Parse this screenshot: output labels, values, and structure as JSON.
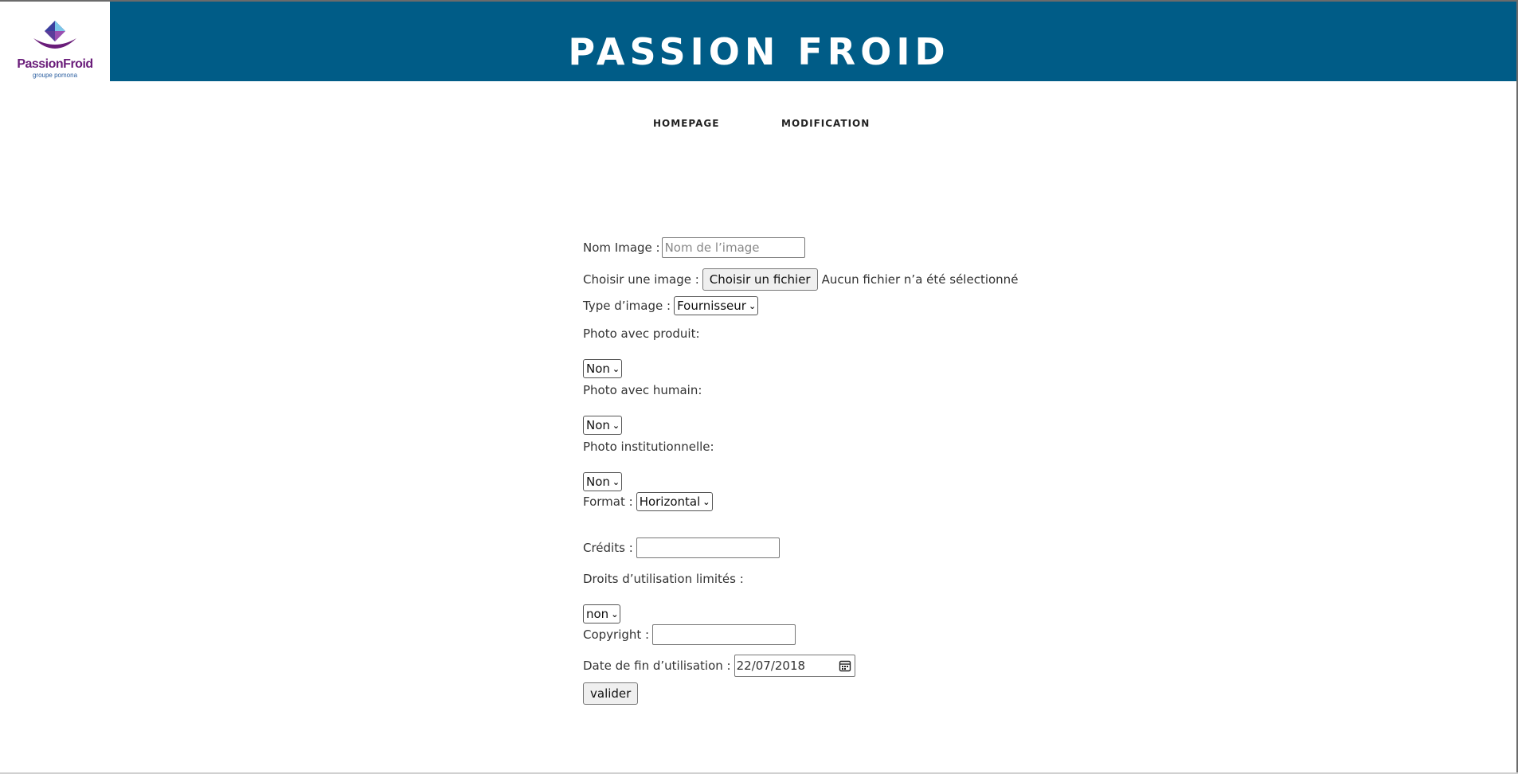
{
  "header": {
    "logo_name": "PassionFroid",
    "logo_sub": "groupe pomona",
    "title": "PASSION FROID"
  },
  "nav": {
    "items": [
      {
        "label": "HOMEPAGE"
      },
      {
        "label": "MODIFICATION"
      }
    ]
  },
  "form": {
    "nom_image": {
      "label": "Nom Image :",
      "placeholder": "Nom de l’image",
      "value": ""
    },
    "choisir_image": {
      "label": "Choisir une image :",
      "button": "Choisir un fichier",
      "status": "Aucun fichier n’a été sélectionné"
    },
    "type_image": {
      "label": "Type d’image :",
      "selected": "Fournisseur"
    },
    "photo_produit": {
      "label": "Photo avec produit:",
      "selected": "Non"
    },
    "photo_humain": {
      "label": "Photo avec humain:",
      "selected": "Non"
    },
    "photo_institutionnelle": {
      "label": "Photo institutionnelle:",
      "selected": "Non"
    },
    "format": {
      "label": "Format :",
      "selected": "Horizontal"
    },
    "credits": {
      "label": "Crédits :",
      "value": ""
    },
    "droits": {
      "label": "Droits d’utilisation limités :",
      "selected": "non"
    },
    "copyright": {
      "label": "Copyright :",
      "value": ""
    },
    "date_fin": {
      "label": "Date de fin d’utilisation :",
      "value": "22/07/2018"
    },
    "submit": "valider"
  },
  "icons": {
    "dropdown": "chevron-down-icon",
    "calendar": "calendar-icon"
  },
  "colors": {
    "header_bg": "#005c87",
    "logo_purple": "#6a1d7a"
  }
}
